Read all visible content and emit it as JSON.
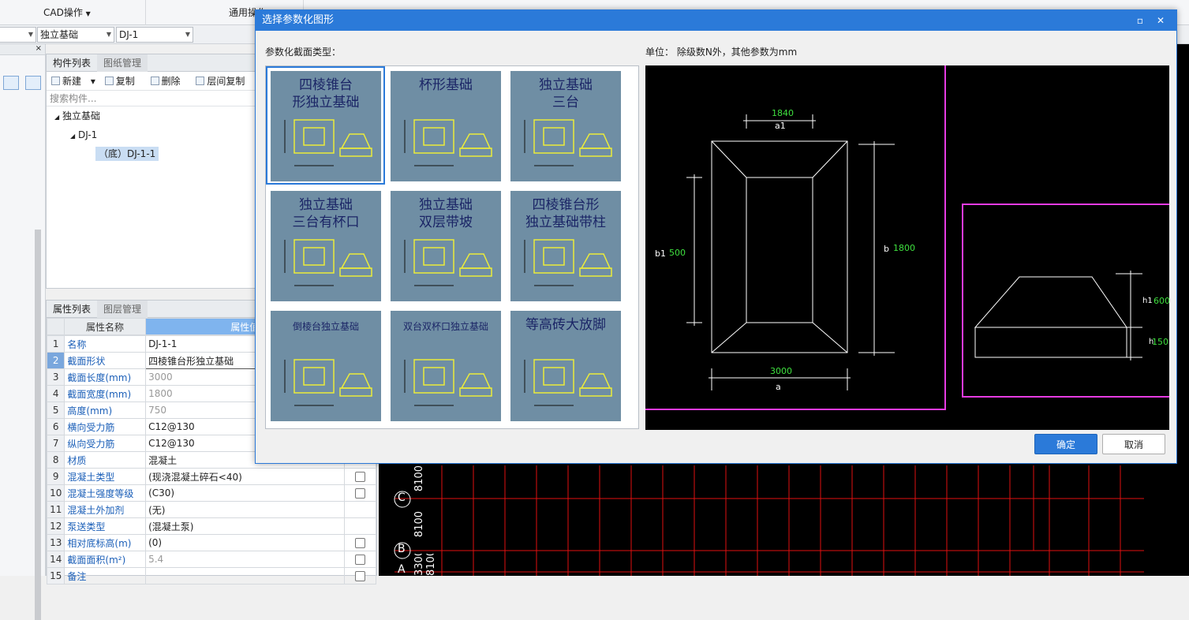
{
  "topbar": {
    "cad_ops": "CAD操作",
    "common": "通用操作"
  },
  "row2": {
    "combo_blank": "",
    "combo_type": "独立基础",
    "combo_item": "DJ-1"
  },
  "complist": {
    "tab_active": "构件列表",
    "tab_inactive": "图纸管理",
    "toolbar": {
      "new": "新建",
      "copy": "复制",
      "delete": "删除",
      "floor_copy": "层间复制"
    },
    "search_placeholder": "搜索构件...",
    "tree": {
      "root": "独立基础",
      "child": "DJ-1",
      "leaf": "（底）DJ-1-1"
    }
  },
  "props": {
    "tab_active": "属性列表",
    "tab_inactive": "图层管理",
    "header_name": "属性名称",
    "header_value": "属性值",
    "rows": [
      {
        "n": "1",
        "name": "名称",
        "value": "DJ-1-1",
        "check": false
      },
      {
        "n": "2",
        "name": "截面形状",
        "value": "四棱锥台形独立基础",
        "check": false
      },
      {
        "n": "3",
        "name": "截面长度(mm)",
        "value": "3000",
        "check": false
      },
      {
        "n": "4",
        "name": "截面宽度(mm)",
        "value": "1800",
        "check": false
      },
      {
        "n": "5",
        "name": "高度(mm)",
        "value": "750",
        "check": false
      },
      {
        "n": "6",
        "name": "横向受力筋",
        "value": "C12@130",
        "check": false
      },
      {
        "n": "7",
        "name": "纵向受力筋",
        "value": "C12@130",
        "check": false
      },
      {
        "n": "8",
        "name": "材质",
        "value": "混凝土",
        "check": false
      },
      {
        "n": "9",
        "name": "混凝土类型",
        "value": "(现浇混凝土碎石<40)",
        "check": true
      },
      {
        "n": "10",
        "name": "混凝土强度等级",
        "value": "(C30)",
        "check": true
      },
      {
        "n": "11",
        "name": "混凝土外加剂",
        "value": "(无)",
        "check": false
      },
      {
        "n": "12",
        "name": "泵送类型",
        "value": "(混凝土泵)",
        "check": false
      },
      {
        "n": "13",
        "name": "相对底标高(m)",
        "value": "(0)",
        "check": true
      },
      {
        "n": "14",
        "name": "截面面积(m²)",
        "value": "5.4",
        "check": true
      },
      {
        "n": "15",
        "name": "备注",
        "value": "",
        "check": true
      }
    ]
  },
  "cad": {
    "axis_c": "C",
    "axis_b": "B",
    "axis_a": "A",
    "dim1": "8100",
    "dim2": "8100",
    "dim3": "3300 8100"
  },
  "dialog": {
    "title": "选择参数化图形",
    "section_label": "参数化截面类型：",
    "unit_label": "单位：  除级数N外，其他参数为mm",
    "ok": "确定",
    "cancel": "取消",
    "thumbs": [
      {
        "line1": "四棱锥台",
        "line2": "形独立基础"
      },
      {
        "line1": "杯形基础",
        "line2": ""
      },
      {
        "line1": "独立基础",
        "line2": "三台"
      },
      {
        "line1": "独立基础",
        "line2": "三台有杯口"
      },
      {
        "line1": "独立基础",
        "line2": "双层带坡"
      },
      {
        "line1": "四棱锥台形",
        "line2": "独立基础带柱"
      },
      {
        "line1": "倒棱台独立基础",
        "line2": ""
      },
      {
        "line1": "双台双杯口独立基础",
        "line2": ""
      },
      {
        "line1": "等高砖大放脚",
        "line2": ""
      }
    ],
    "preview": {
      "a1_value": "1840",
      "a1_label": "a1",
      "b1_label": "b1",
      "b1_value": "500",
      "b_label": "b",
      "b_value": "1800",
      "a_value": "3000",
      "a_label": "a",
      "h1_label": "h1",
      "h1_value": "600",
      "h_label": "h",
      "h_value": "150"
    }
  }
}
